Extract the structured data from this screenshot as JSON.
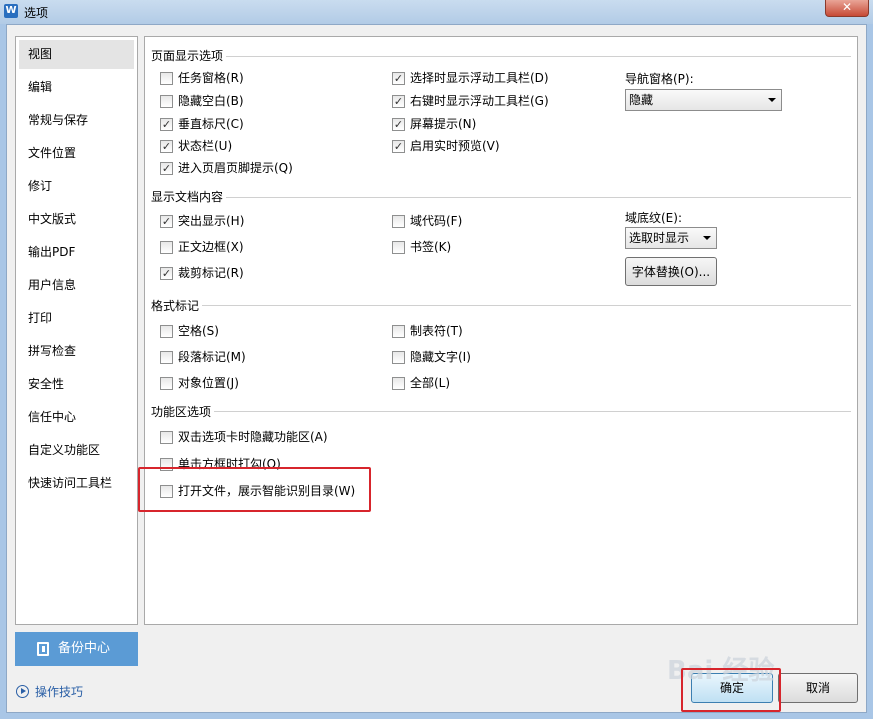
{
  "window": {
    "title": "选项",
    "app_icon": "W",
    "close": "✕"
  },
  "sidebar": {
    "items": [
      {
        "label": "视图",
        "active": true
      },
      {
        "label": "编辑"
      },
      {
        "label": "常规与保存"
      },
      {
        "label": "文件位置"
      },
      {
        "label": "修订"
      },
      {
        "label": "中文版式"
      },
      {
        "label": "输出PDF"
      },
      {
        "label": "用户信息"
      },
      {
        "label": "打印"
      },
      {
        "label": "拼写检查"
      },
      {
        "label": "安全性"
      },
      {
        "label": "信任中心"
      },
      {
        "label": "自定义功能区"
      },
      {
        "label": "快速访问工具栏"
      }
    ],
    "backup_label": "备份中心",
    "tips_label": "操作技巧"
  },
  "page_display": {
    "title": "页面显示选项",
    "col1": [
      {
        "label": "任务窗格(R)",
        "checked": false
      },
      {
        "label": "隐藏空白(B)",
        "checked": false
      },
      {
        "label": "垂直标尺(C)",
        "checked": true
      },
      {
        "label": "状态栏(U)",
        "checked": true
      },
      {
        "label": "进入页眉页脚提示(Q)",
        "checked": true
      }
    ],
    "col2": [
      {
        "label": "选择时显示浮动工具栏(D)",
        "checked": true
      },
      {
        "label": "右键时显示浮动工具栏(G)",
        "checked": true
      },
      {
        "label": "屏幕提示(N)",
        "checked": true
      },
      {
        "label": "启用实时预览(V)",
        "checked": true
      }
    ],
    "nav_label": "导航窗格(P):",
    "nav_value": "隐藏"
  },
  "doc_content": {
    "title": "显示文档内容",
    "col1": [
      {
        "label": "突出显示(H)",
        "checked": true
      },
      {
        "label": "正文边框(X)",
        "checked": false
      },
      {
        "label": "裁剪标记(R)",
        "checked": true
      }
    ],
    "col2": [
      {
        "label": "域代码(F)",
        "checked": false
      },
      {
        "label": "书签(K)",
        "checked": false
      }
    ],
    "field_label": "域底纹(E):",
    "field_value": "选取时显示",
    "font_sub_button": "字体替换(O)..."
  },
  "format_marks": {
    "title": "格式标记",
    "col1": [
      {
        "label": "空格(S)",
        "checked": false
      },
      {
        "label": "段落标记(M)",
        "checked": false
      },
      {
        "label": "对象位置(J)",
        "checked": false
      }
    ],
    "col2": [
      {
        "label": "制表符(T)",
        "checked": false
      },
      {
        "label": "隐藏文字(I)",
        "checked": false
      },
      {
        "label": "全部(L)",
        "checked": false
      }
    ]
  },
  "ribbon": {
    "title": "功能区选项",
    "items": [
      {
        "label": "双击选项卡时隐藏功能区(A)",
        "checked": false
      },
      {
        "label": "单击方框时打勾(O)",
        "checked": false
      },
      {
        "label": "打开文件，展示智能识别目录(W)",
        "checked": false
      }
    ]
  },
  "footer": {
    "ok": "确定",
    "cancel": "取消"
  },
  "watermark": "Bai 经验",
  "check_glyph": "✓",
  "colors": {
    "accent": "#5b9bd5",
    "highlight": "#d7252c"
  }
}
